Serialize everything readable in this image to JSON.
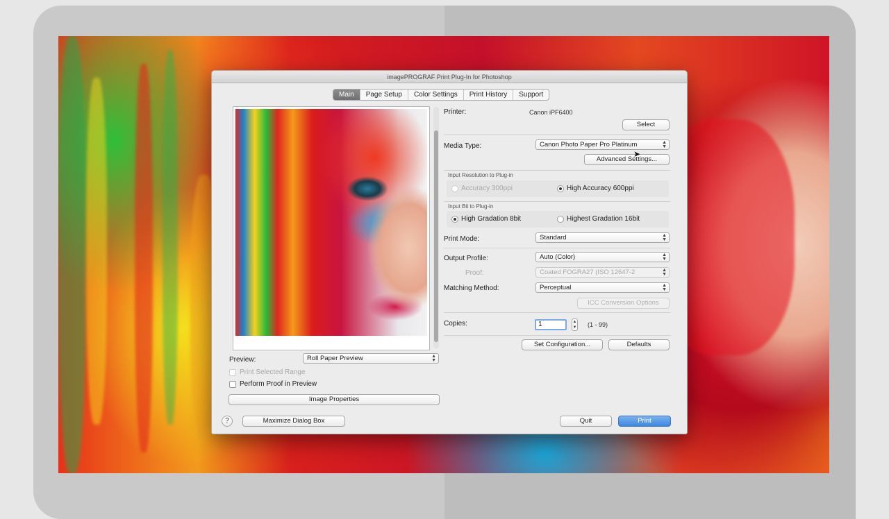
{
  "dialog": {
    "title": "imagePROGRAF Print Plug-In for Photoshop",
    "tabs": [
      "Main",
      "Page Setup",
      "Color Settings",
      "Print History",
      "Support"
    ],
    "active_tab": "Main"
  },
  "preview": {
    "label": "Preview:",
    "mode": "Roll Paper Preview",
    "print_selected_range": "Print Selected Range",
    "perform_proof": "Perform Proof in Preview",
    "image_properties": "Image Properties"
  },
  "printer": {
    "label": "Printer:",
    "name": "Canon iPF6400",
    "select_button": "Select"
  },
  "media": {
    "label": "Media Type:",
    "value": "Canon Photo Paper Pro Platinum",
    "advanced_button": "Advanced Settings..."
  },
  "input_resolution": {
    "group_label": "Input Resolution to Plug-in",
    "option_accuracy": "Accuracy 300ppi",
    "option_high_accuracy": "High Accuracy 600ppi",
    "selected": "High Accuracy 600ppi"
  },
  "input_bit": {
    "group_label": "Input Bit to Plug-in",
    "option_8bit": "High Gradation 8bit",
    "option_16bit": "Highest Gradation 16bit",
    "selected": "High Gradation 8bit"
  },
  "print_mode": {
    "label": "Print Mode:",
    "value": "Standard"
  },
  "output_profile": {
    "label": "Output Profile:",
    "value": "Auto (Color)",
    "proof_label": "Proof:",
    "proof_value": "Coated FOGRA27 (ISO 12647-2"
  },
  "matching": {
    "label": "Matching Method:",
    "value": "Perceptual",
    "icc_button": "ICC Conversion Options"
  },
  "copies": {
    "label": "Copies:",
    "value": "1",
    "range": "(1 - 99)"
  },
  "buttons": {
    "set_configuration": "Set Configuration...",
    "defaults": "Defaults",
    "help": "?",
    "maximize": "Maximize Dialog Box",
    "quit": "Quit",
    "print": "Print"
  }
}
